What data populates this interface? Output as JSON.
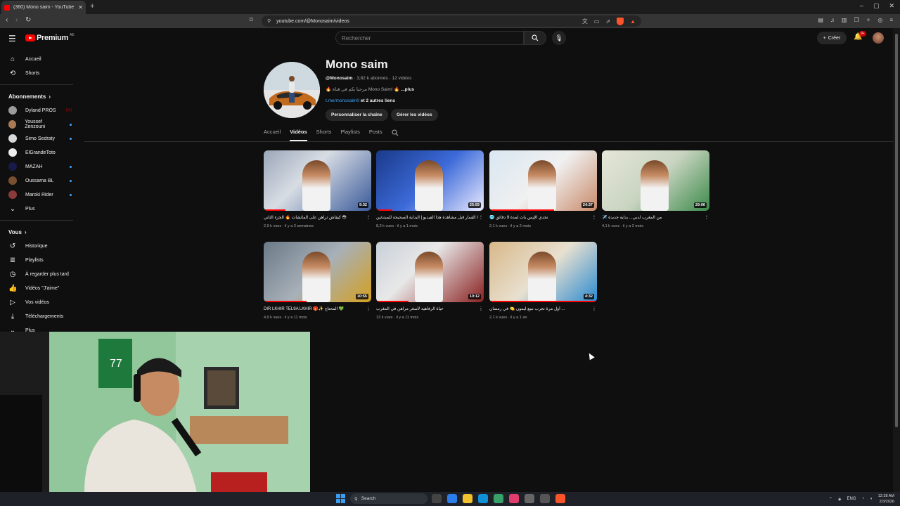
{
  "browser": {
    "tab_title": "(360) Mono saim - YouTube",
    "new_tab": "+",
    "url": "youtube.com/@Monosaim/videos",
    "window_controls": [
      "–",
      "▢",
      "✕"
    ]
  },
  "yt_header": {
    "logo": "Premium",
    "country": "AE",
    "search_placeholder": "Rechercher",
    "create_label": "Créer",
    "notif_count": "9+"
  },
  "sidebar": {
    "main": [
      {
        "icon": "home-icon",
        "label": "Accueil"
      },
      {
        "icon": "shorts-icon",
        "label": "Shorts"
      }
    ],
    "subs_title": "Abonnements",
    "subs": [
      {
        "label": "Dyland PROS",
        "color": "#9b9b9b",
        "live": true
      },
      {
        "label": "Youssef Zenzouni",
        "color": "#a87a55",
        "dot": true
      },
      {
        "label": "Simo Sedraty",
        "color": "#d9d9d9",
        "dot": true
      },
      {
        "label": "ElGrandeToto",
        "color": "#eeeeee",
        "dot": false
      },
      {
        "label": "MAZAH",
        "color": "#1a1a4a",
        "dot": true
      },
      {
        "label": "Oussama BL",
        "color": "#7a5030",
        "dot": true
      },
      {
        "label": "Maroki Rider",
        "color": "#8b3a3a",
        "dot": true
      }
    ],
    "more_label": "Plus",
    "you_title": "Vous",
    "you_items": [
      {
        "icon": "history-icon",
        "label": "Historique"
      },
      {
        "icon": "playlists-icon",
        "label": "Playlists"
      },
      {
        "icon": "watch-later-icon",
        "label": "À regarder plus tard"
      },
      {
        "icon": "like-icon",
        "label": "Vidéos \"J'aime\""
      },
      {
        "icon": "your-videos-icon",
        "label": "Vos vidéos"
      },
      {
        "icon": "download-icon",
        "label": "Téléchargements"
      },
      {
        "icon": "chevron-down-icon",
        "label": "Plus"
      }
    ]
  },
  "channel": {
    "name": "Mono saim",
    "handle": "@Monosaim",
    "meta": " · 3,82 k abonnés · 12 vidéos",
    "desc": "🔥 مرحبا بكم في قناة Mono Saim! 🔥 ",
    "desc_more": "...plus",
    "link": "t.me/monosaim0",
    "link_more": " et 2 autres liens",
    "btn_customize": "Personnaliser la chaîne",
    "btn_manage": "Gérer les vidéos",
    "tabs": [
      "Accueil",
      "Vidéos",
      "Shorts",
      "Playlists",
      "Posts"
    ]
  },
  "videos": [
    {
      "title": "كيفاش تراهن على الماتشات 🔥 الجزء الثاني 😳",
      "meta": "2,9 k vues · il y a 3 semaines",
      "duration": "9:32",
      "progress": 0.2
    },
    {
      "title": "لا تبدا القمار قبل مشاهدة هذا الفيديو | البداية الصحيحة للمبتدئين",
      "meta": "8,2 k vues · il y a 1 mois",
      "duration": "25:59",
      "progress": 0.15
    },
    {
      "title": "🥶 تحدي الإيس باث لمدة 9 دقائق",
      "meta": "2,1 k vues · il y a 2 mois",
      "duration": "24:37",
      "progress": 0.6
    },
    {
      "title": "✈️ من المغرب لدبي... بداية جديدة",
      "meta": "4,1 k vues · il y a 2 mois",
      "duration": "29:06",
      "progress": 0
    },
    {
      "title": "DIR LKHIR TEL9A LKHIR 🎁✨ المحتاج 💚",
      "meta": "4,9 k vues · il y a 11 mois",
      "duration": "10:55",
      "progress": 0.4
    },
    {
      "title": "حياة الرفاهية لأصغر مراهن في المغرب",
      "meta": "13 k vues · il y a 11 mois",
      "duration": "10:12",
      "progress": 0.3
    },
    {
      "title": "أول مرة نجرب نبيع ليمون 🍋 في رمضان ...",
      "meta": "2,1 k vues · il y a 1 an",
      "duration": "4:32",
      "progress": 1.0
    }
  ],
  "taskbar": {
    "search_label": "Search",
    "lang": "ENG",
    "time": "12:38 AM",
    "date": "2/3/2026"
  }
}
